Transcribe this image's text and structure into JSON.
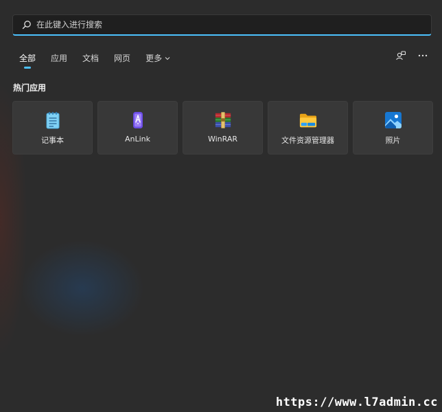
{
  "search": {
    "placeholder": "在此键入进行搜索",
    "value": ""
  },
  "tabs": [
    {
      "label": "全部",
      "active": true
    },
    {
      "label": "应用",
      "active": false
    },
    {
      "label": "文档",
      "active": false
    },
    {
      "label": "网页",
      "active": false
    },
    {
      "label": "更多",
      "active": false,
      "dropdown": true
    }
  ],
  "toolbar": {
    "icons": [
      "account-switch-icon",
      "more-options-icon"
    ]
  },
  "top_apps": {
    "title": "热门应用",
    "items": [
      {
        "label": "记事本",
        "icon": "notepad-icon"
      },
      {
        "label": "AnLink",
        "icon": "anlink-icon"
      },
      {
        "label": "WinRAR",
        "icon": "winrar-icon"
      },
      {
        "label": "文件资源管理器",
        "icon": "file-explorer-icon"
      },
      {
        "label": "照片",
        "icon": "photos-icon"
      }
    ]
  },
  "watermark": "https://www.l7admin.cc",
  "colors": {
    "accent": "#4cc2ff",
    "background": "#2c2c2c",
    "tile": "#383838"
  }
}
